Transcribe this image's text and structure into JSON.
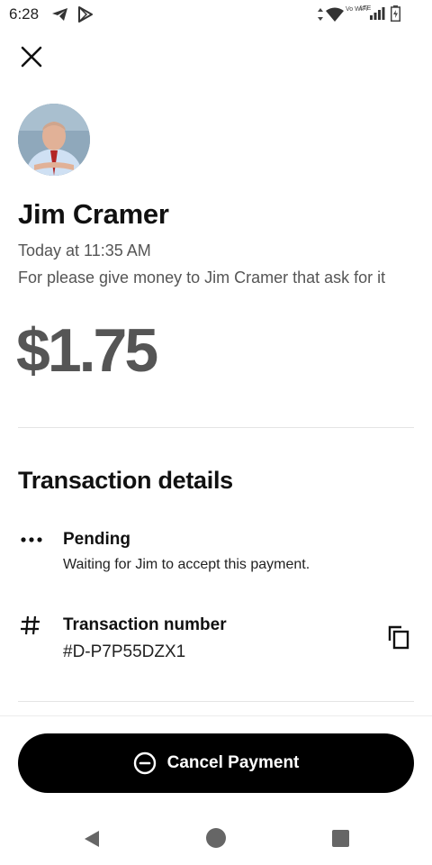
{
  "status_bar": {
    "time": "6:28",
    "icons": [
      "telegram-icon",
      "play-store-icon",
      "data-arrows-icon",
      "wifi-icon",
      "vowifi-icon",
      "lte-signal-icon",
      "battery-icon"
    ],
    "vowifi_label": "Vo WiFi",
    "lte_label": "LTE"
  },
  "header": {
    "close_icon": "close-icon"
  },
  "payment": {
    "recipient_name": "Jim Cramer",
    "timestamp": "Today at 11:35 AM",
    "note": "For please give money to Jim Cramer that ask for it",
    "amount": "$1.75"
  },
  "details": {
    "title": "Transaction details",
    "status": {
      "icon": "ellipsis-icon",
      "label": "Pending",
      "description": "Waiting for Jim to accept this payment."
    },
    "transaction": {
      "icon": "hash-icon",
      "label": "Transaction number",
      "value": "#D-P7P55DZX1",
      "copy_icon": "copy-icon"
    }
  },
  "footer": {
    "cancel_label": "Cancel Payment",
    "cancel_icon": "minus-circle-icon"
  },
  "nav": {
    "back_icon": "nav-back-icon",
    "home_icon": "nav-home-icon",
    "recents_icon": "nav-recents-icon"
  },
  "colors": {
    "primary": "#000000",
    "amount_gray": "#555555",
    "secondary_text": "#555555",
    "divider": "#e4e4e4"
  }
}
